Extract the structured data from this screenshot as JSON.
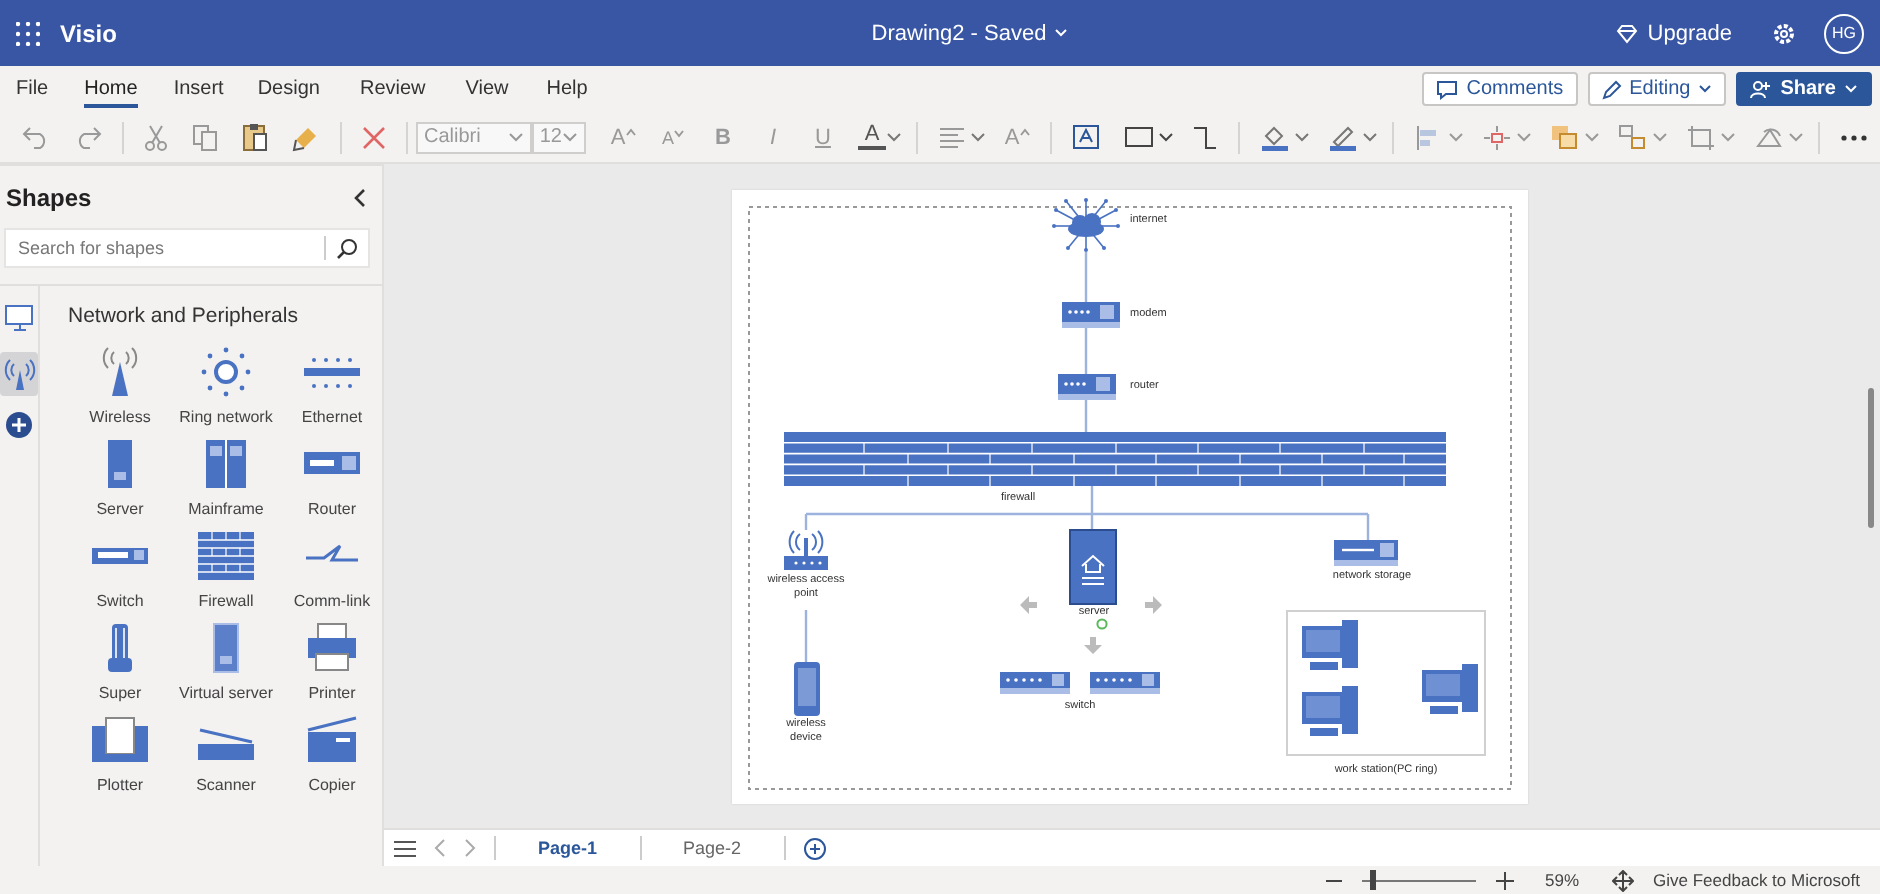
{
  "app_bar": {
    "app_name": "Visio",
    "document_title": "Drawing2 - Saved",
    "upgrade": "Upgrade",
    "avatar": "HG"
  },
  "ribbon": {
    "tabs": [
      {
        "label": "File",
        "selected": false
      },
      {
        "label": "Home",
        "selected": true
      },
      {
        "label": "Insert",
        "selected": false
      },
      {
        "label": "Design",
        "selected": false
      },
      {
        "label": "Review",
        "selected": false
      },
      {
        "label": "View",
        "selected": false
      },
      {
        "label": "Help",
        "selected": false
      }
    ],
    "comments": "Comments",
    "editing": "Editing",
    "share": "Share"
  },
  "toolbar": {
    "font": "Calibri",
    "font_size": "12",
    "grow_font": "A",
    "shrink_font": "A",
    "bold": "B",
    "italic": "I",
    "underline": "U",
    "font_color": "A",
    "text_style": "A"
  },
  "shapes_panel": {
    "title": "Shapes",
    "search_placeholder": "Search for shapes",
    "categories": [
      {
        "kind": "computers",
        "selected": false
      },
      {
        "kind": "network",
        "selected": true
      }
    ],
    "stencil_title": "Network and Peripherals",
    "shapes": [
      {
        "kind": "wireless",
        "label": "Wireless"
      },
      {
        "kind": "ring",
        "label": "Ring network"
      },
      {
        "kind": "ethernet",
        "label": "Ethernet"
      },
      {
        "kind": "server",
        "label": "Server"
      },
      {
        "kind": "mainframe",
        "label": "Mainframe"
      },
      {
        "kind": "router",
        "label": "Router"
      },
      {
        "kind": "switch",
        "label": "Switch"
      },
      {
        "kind": "firewall",
        "label": "Firewall"
      },
      {
        "kind": "commlink",
        "label": "Comm-link"
      },
      {
        "kind": "super",
        "label": "Super"
      },
      {
        "kind": "virtual",
        "label": "Virtual server"
      },
      {
        "kind": "printer",
        "label": "Printer"
      },
      {
        "kind": "plotter",
        "label": "Plotter"
      },
      {
        "kind": "scanner",
        "label": "Scanner"
      },
      {
        "kind": "copier",
        "label": "Copier"
      }
    ]
  },
  "diagram": {
    "nodes": [
      {
        "kind": "cloud",
        "label": "internet",
        "selected": false
      },
      {
        "kind": "modem",
        "label": "modem",
        "selected": false
      },
      {
        "kind": "router",
        "label": "router",
        "selected": false
      },
      {
        "kind": "firewall",
        "label": "firewall",
        "selected": false
      },
      {
        "kind": "access_point",
        "label": "wireless access point",
        "selected": false
      },
      {
        "kind": "mobile",
        "label": "wireless device",
        "selected": false
      },
      {
        "kind": "server",
        "label": "server",
        "selected": true
      },
      {
        "kind": "storage",
        "label": "network storage",
        "selected": false
      },
      {
        "kind": "switch",
        "label": "switch",
        "selected": false
      },
      {
        "kind": "workstations",
        "label": "work station(PC ring)",
        "selected": false
      }
    ]
  },
  "page_tabs": [
    {
      "label": "Page-1",
      "selected": true
    },
    {
      "label": "Page-2",
      "selected": false
    }
  ],
  "status_bar": {
    "zoom": {
      "level": 0.1,
      "reading": "59%"
    },
    "feedback": "Give Feedback to Microsoft"
  }
}
